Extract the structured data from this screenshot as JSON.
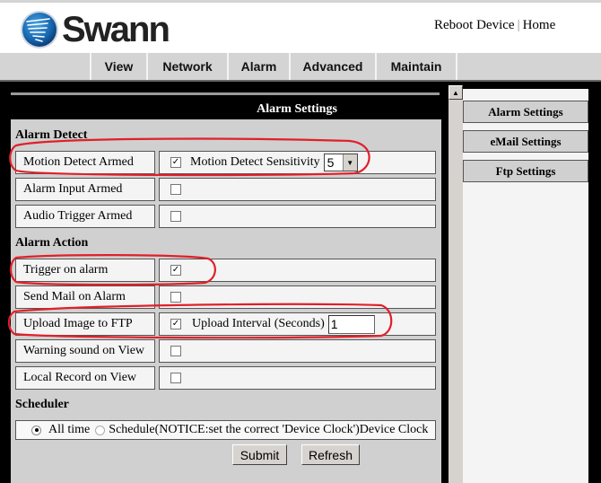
{
  "brand": {
    "name": "Swann",
    "trademark": "."
  },
  "header_links": {
    "reboot": "Reboot Device",
    "separator": "|",
    "home": "Home"
  },
  "nav": {
    "items": [
      "View",
      "Network",
      "Alarm",
      "Advanced",
      "Maintain"
    ],
    "active": "Alarm"
  },
  "panel": {
    "title": "Alarm Settings"
  },
  "alarm_detect": {
    "heading": "Alarm Detect",
    "rows": [
      {
        "label": "Motion Detect Armed",
        "checked": true,
        "extra_label": "Motion Detect Sensitivity",
        "select_value": "5"
      },
      {
        "label": "Alarm Input Armed",
        "checked": false
      },
      {
        "label": "Audio Trigger Armed",
        "checked": false
      }
    ]
  },
  "alarm_action": {
    "heading": "Alarm Action",
    "rows": [
      {
        "label": "Trigger on alarm",
        "checked": true
      },
      {
        "label": "Send Mail on Alarm",
        "checked": false
      },
      {
        "label": "Upload Image to FTP",
        "checked": true,
        "extra_label": "Upload Interval (Seconds)",
        "input_value": "1"
      },
      {
        "label": "Warning sound on View",
        "checked": false
      },
      {
        "label": "Local Record on View",
        "checked": false
      }
    ]
  },
  "scheduler": {
    "heading": "Scheduler",
    "options": [
      {
        "label": "All time",
        "selected": true
      },
      {
        "label": "Schedule(NOTICE:set the correct 'Device Clock')Device Clock",
        "selected": false
      }
    ]
  },
  "buttons": {
    "submit": "Submit",
    "refresh": "Refresh"
  },
  "sidebar": {
    "items": [
      "Alarm Settings",
      "eMail Settings",
      "Ftp Settings"
    ]
  },
  "checkmark": "✓",
  "icons": {
    "dropdown": "▼",
    "scroll_up": "▲"
  },
  "colors": {
    "annotation": "#e0202a",
    "nav_bg": "#d4d4d4",
    "panel_bg": "#d0d0d0",
    "frame": "#000000"
  }
}
